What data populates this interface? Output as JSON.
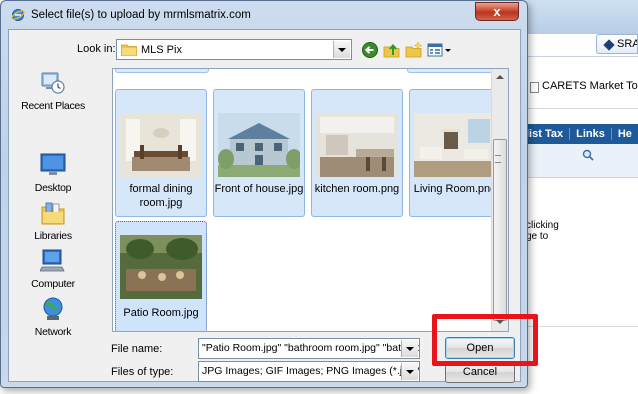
{
  "background_page": {
    "toolbar_button_label": "SRA",
    "carets_tab": "CARETS Market Too",
    "nav_items": [
      "list Tax",
      "Links",
      "He"
    ],
    "text_lines": [
      "clicking",
      "ge to"
    ]
  },
  "dialog": {
    "title": "Select file(s) to upload by mrmlsmatrix.com",
    "close_glyph": "x",
    "look_in_label": "Look in:",
    "look_in_value": "MLS Pix",
    "places": [
      {
        "label": "Recent Places",
        "icon": "recent-places-icon"
      },
      {
        "label": "Desktop",
        "icon": "desktop-icon"
      },
      {
        "label": "Libraries",
        "icon": "libraries-icon"
      },
      {
        "label": "Computer",
        "icon": "computer-icon"
      },
      {
        "label": "Network",
        "icon": "network-icon"
      }
    ],
    "files": [
      {
        "name": "formal dining room.jpg",
        "selected": true
      },
      {
        "name": "Front of house.jpg",
        "selected": true
      },
      {
        "name": "kitchen room.png",
        "selected": true
      },
      {
        "name": "Living Room.png",
        "selected": true
      },
      {
        "name": "Patio Room.jpg",
        "selected": true,
        "focused": true
      }
    ],
    "file_name_label": "File name:",
    "file_name_value": "\"Patio Room.jpg\" \"bathroom room.jpg\" \"bathroo",
    "file_type_label": "Files of type:",
    "file_type_value": "JPG Images; GIF Images; PNG Images (*.jpg;*.j",
    "open_button": "Open",
    "cancel_button": "Cancel"
  },
  "colors": {
    "highlight": "#e8141c",
    "selection_fill": "#d6e7fa",
    "title_close": "#c9472f"
  }
}
